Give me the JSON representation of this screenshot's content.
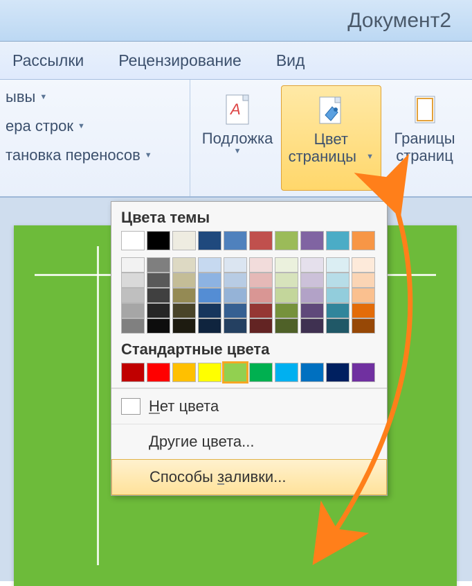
{
  "title": "Документ2",
  "tabs": [
    "Рассылки",
    "Рецензирование",
    "Вид"
  ],
  "left_group": {
    "breaks": "ывы",
    "line_numbers": "ера строк",
    "hyphenation": "тановка переносов"
  },
  "ribbon": {
    "watermark": {
      "label": "Подложка"
    },
    "page_color": {
      "label1": "Цвет",
      "label2": "страницы"
    },
    "page_borders": {
      "label1": "Границы",
      "label2": "страниц"
    }
  },
  "popup": {
    "theme_title": "Цвета темы",
    "theme_row0": [
      "#ffffff",
      "#000000",
      "#eeece1",
      "#1f497d",
      "#4f81bd",
      "#c0504d",
      "#9bbb59",
      "#8064a2",
      "#4bacc6",
      "#f79646"
    ],
    "theme_tints": [
      [
        "#f2f2f2",
        "#7f7f7f",
        "#ddd9c3",
        "#c6d9f0",
        "#dbe5f1",
        "#f2dcdb",
        "#ebf1dd",
        "#e5e0ec",
        "#dbeef3",
        "#fdeada"
      ],
      [
        "#d9d9d9",
        "#595959",
        "#c4bd97",
        "#8db3e2",
        "#b8cce4",
        "#e5b9b7",
        "#d7e3bc",
        "#ccc1d9",
        "#b7dde8",
        "#fbd5b5"
      ],
      [
        "#bfbfbf",
        "#404040",
        "#948a54",
        "#548dd4",
        "#95b3d7",
        "#d99694",
        "#c3d69b",
        "#b2a2c7",
        "#92cddc",
        "#fac08f"
      ],
      [
        "#a6a6a6",
        "#262626",
        "#494429",
        "#17365d",
        "#366092",
        "#953734",
        "#76923c",
        "#5f497a",
        "#31859b",
        "#e36c09"
      ],
      [
        "#808080",
        "#0d0d0d",
        "#1d1b10",
        "#0f243e",
        "#244061",
        "#632423",
        "#4f6128",
        "#3f3151",
        "#205867",
        "#974806"
      ]
    ],
    "standard_title": "Стандартные цвета",
    "standard_colors": [
      "#c00000",
      "#ff0000",
      "#ffc000",
      "#ffff00",
      "#92d050",
      "#00b050",
      "#00b0f0",
      "#0070c0",
      "#002060",
      "#7030a0"
    ],
    "selected_standard_index": 4,
    "no_color": "Нет цвета",
    "more_colors": "Другие цвета...",
    "fill_effects": "Способы заливки..."
  },
  "annotation_color": "#ff7f1a"
}
